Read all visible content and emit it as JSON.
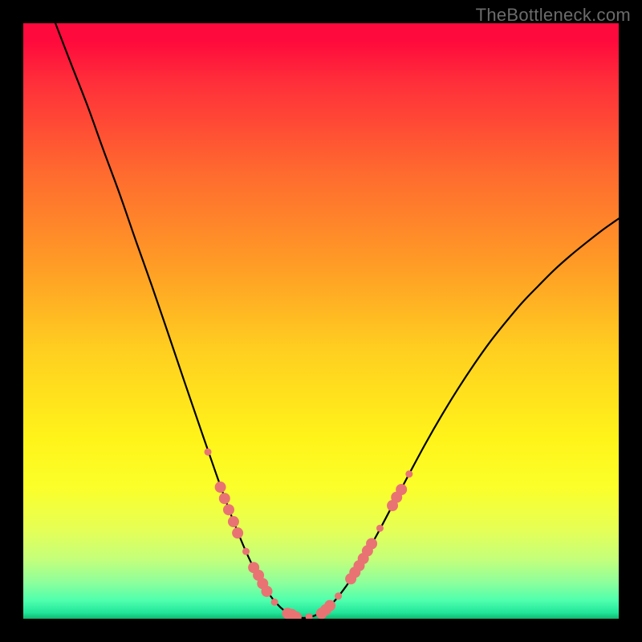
{
  "watermark": "TheBottleneck.com",
  "chart_data": {
    "type": "line",
    "title": "",
    "xlabel": "",
    "ylabel": "",
    "xlim": [
      0,
      100
    ],
    "ylim": [
      0,
      100
    ],
    "x": [
      5.4,
      8.1,
      10.8,
      13.5,
      16.2,
      18.9,
      21.6,
      24.3,
      27.0,
      29.7,
      32.4,
      35.1,
      37.8,
      40.5,
      43.2,
      45.9,
      48.6,
      51.4,
      54.1,
      56.8,
      59.5,
      62.2,
      64.9,
      67.6,
      70.3,
      73.0,
      75.7,
      78.4,
      81.1,
      83.8,
      86.5,
      89.2,
      91.9,
      94.6,
      97.3,
      100.0
    ],
    "values": [
      100.0,
      93.0,
      86.1,
      78.6,
      71.3,
      63.5,
      55.9,
      48.0,
      40.0,
      32.1,
      24.3,
      16.9,
      10.4,
      5.3,
      1.9,
      0.3,
      0.4,
      2.1,
      5.3,
      9.5,
      14.3,
      19.4,
      24.5,
      29.5,
      34.2,
      38.6,
      42.7,
      46.5,
      49.9,
      53.1,
      55.9,
      58.6,
      61.0,
      63.2,
      65.3,
      67.2
    ],
    "series": [
      {
        "name": "curve",
        "x": [
          5.4,
          8.1,
          10.8,
          13.5,
          16.2,
          18.9,
          21.6,
          24.3,
          27.0,
          29.7,
          32.4,
          35.1,
          37.8,
          40.5,
          43.2,
          45.9,
          48.6,
          51.4,
          54.1,
          56.8,
          59.5,
          62.2,
          64.9,
          67.6,
          70.3,
          73.0,
          75.7,
          78.4,
          81.1,
          83.8,
          86.5,
          89.2,
          91.9,
          94.6,
          97.3,
          100.0
        ],
        "values": [
          100.0,
          93.0,
          86.1,
          78.6,
          71.3,
          63.5,
          55.9,
          48.0,
          40.0,
          32.1,
          24.3,
          16.9,
          10.4,
          5.3,
          1.9,
          0.3,
          0.4,
          2.1,
          5.3,
          9.5,
          14.3,
          19.4,
          24.5,
          29.5,
          34.2,
          38.6,
          42.7,
          46.5,
          49.9,
          53.1,
          55.9,
          58.6,
          61.0,
          63.2,
          65.3,
          67.2
        ]
      }
    ],
    "markers": {
      "color": "#e97373",
      "radius_small": 4.5,
      "radius_large": 7,
      "points": [
        {
          "x": 31.0,
          "y": 28.0,
          "r": "small"
        },
        {
          "x": 33.1,
          "y": 22.1,
          "r": "large"
        },
        {
          "x": 33.8,
          "y": 20.2,
          "r": "large"
        },
        {
          "x": 34.5,
          "y": 18.3,
          "r": "large"
        },
        {
          "x": 35.3,
          "y": 16.3,
          "r": "large"
        },
        {
          "x": 36.0,
          "y": 14.4,
          "r": "large"
        },
        {
          "x": 37.4,
          "y": 11.3,
          "r": "small"
        },
        {
          "x": 38.7,
          "y": 8.6,
          "r": "large"
        },
        {
          "x": 39.5,
          "y": 7.3,
          "r": "large"
        },
        {
          "x": 40.2,
          "y": 5.9,
          "r": "large"
        },
        {
          "x": 40.9,
          "y": 4.6,
          "r": "large"
        },
        {
          "x": 42.2,
          "y": 2.8,
          "r": "small"
        },
        {
          "x": 44.4,
          "y": 0.9,
          "r": "large"
        },
        {
          "x": 45.1,
          "y": 0.7,
          "r": "large"
        },
        {
          "x": 45.8,
          "y": 0.3,
          "r": "large"
        },
        {
          "x": 48.0,
          "y": 0.3,
          "r": "small"
        },
        {
          "x": 50.1,
          "y": 0.9,
          "r": "large"
        },
        {
          "x": 50.8,
          "y": 1.5,
          "r": "large"
        },
        {
          "x": 51.5,
          "y": 2.2,
          "r": "large"
        },
        {
          "x": 52.9,
          "y": 3.8,
          "r": "small"
        },
        {
          "x": 55.0,
          "y": 6.7,
          "r": "large"
        },
        {
          "x": 55.7,
          "y": 7.8,
          "r": "large"
        },
        {
          "x": 56.4,
          "y": 8.9,
          "r": "large"
        },
        {
          "x": 57.1,
          "y": 10.1,
          "r": "large"
        },
        {
          "x": 57.8,
          "y": 11.4,
          "r": "large"
        },
        {
          "x": 58.5,
          "y": 12.6,
          "r": "large"
        },
        {
          "x": 59.9,
          "y": 15.2,
          "r": "small"
        },
        {
          "x": 62.0,
          "y": 19.0,
          "r": "large"
        },
        {
          "x": 62.7,
          "y": 20.4,
          "r": "large"
        },
        {
          "x": 63.5,
          "y": 21.7,
          "r": "large"
        },
        {
          "x": 64.8,
          "y": 24.3,
          "r": "small"
        }
      ]
    }
  },
  "colors": {
    "frame": "#000000",
    "curve": "#000000",
    "marker": "#e97373",
    "watermark": "#6b6b6b"
  }
}
